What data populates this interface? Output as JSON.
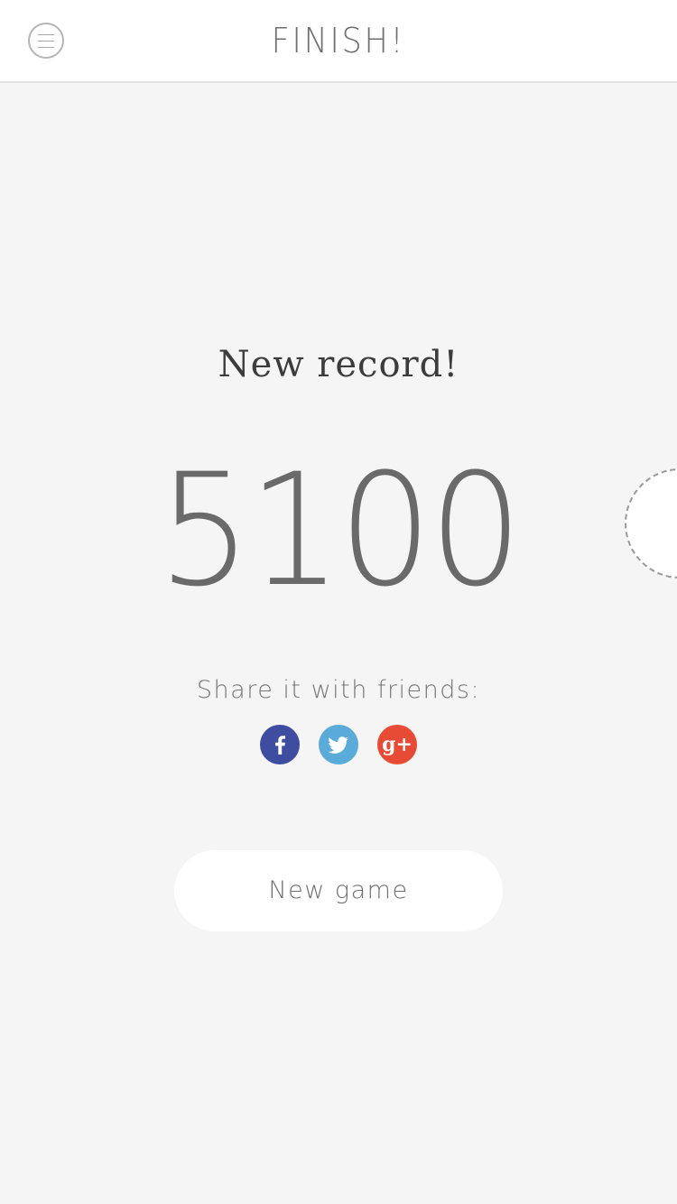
{
  "header": {
    "title": "FINISH!",
    "menu_icon": "hamburger-menu-icon"
  },
  "result": {
    "heading": "New record!",
    "score": "5100"
  },
  "share": {
    "label": "Share it with friends:",
    "networks": [
      {
        "name": "facebook",
        "icon": "facebook-icon",
        "glyph": "f",
        "color": "#3f4da0"
      },
      {
        "name": "twitter",
        "icon": "twitter-icon",
        "glyph": "",
        "color": "#5aabd9"
      },
      {
        "name": "google-plus",
        "icon": "google-plus-icon",
        "glyph": "g+",
        "color": "#e74a35"
      }
    ]
  },
  "actions": {
    "new_game_label": "New game"
  },
  "colors": {
    "background": "#f5f5f5",
    "header_background": "#ffffff",
    "text": "#6a6a6a"
  }
}
